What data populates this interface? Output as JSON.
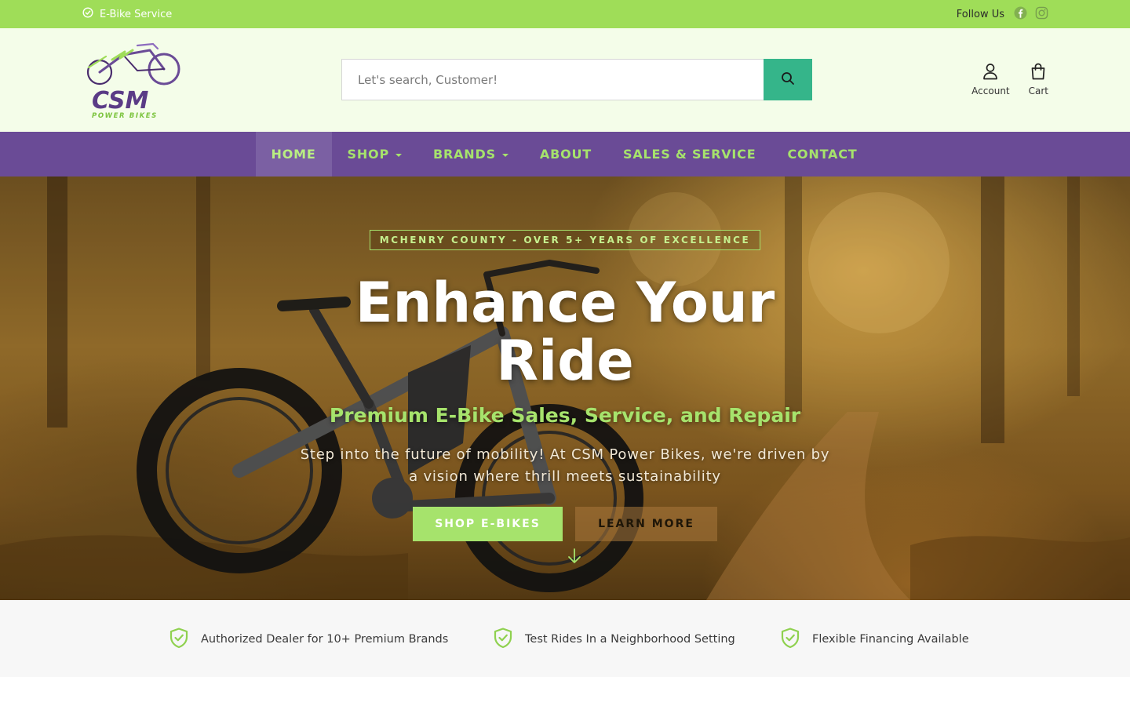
{
  "topbar": {
    "service_label": "E-Bike Service",
    "follow_label": "Follow Us",
    "background": "#9fdd58",
    "icons": [
      "check-circle-icon",
      "facebook-icon",
      "instagram-icon"
    ]
  },
  "header": {
    "logo": {
      "brand": "CSM",
      "tagline": "POWER BIKES"
    },
    "search": {
      "placeholder": "Let's search, Customer!",
      "value": ""
    },
    "account_label": "Account",
    "cart_label": "Cart",
    "background": "#f4fde9",
    "search_button_color": "#35b58a"
  },
  "nav": {
    "background": "#6a4b96",
    "text_color": "#a6e36c",
    "items": [
      {
        "label": "HOME",
        "active": true,
        "dropdown": false
      },
      {
        "label": "SHOP",
        "active": false,
        "dropdown": true
      },
      {
        "label": "BRANDS",
        "active": false,
        "dropdown": true
      },
      {
        "label": "ABOUT",
        "active": false,
        "dropdown": false
      },
      {
        "label": "SALES & SERVICE",
        "active": false,
        "dropdown": false
      },
      {
        "label": "CONTACT",
        "active": false,
        "dropdown": false
      }
    ]
  },
  "hero": {
    "badge": "MCHENRY COUNTY - OVER 5+ YEARS OF EXCELLENCE",
    "title_line1": "Enhance Your",
    "title_line2": "Ride",
    "subtitle": "Premium E-Bike Sales, Service, and Repair",
    "description": "Step into the future of mobility! At CSM Power Bikes, we're driven by a vision where thrill meets sustainability",
    "primary_cta": "SHOP E-BIKES",
    "secondary_cta": "LEARN MORE",
    "accent": "#a6e36c"
  },
  "features": [
    {
      "icon": "shield-check-icon",
      "text": "Authorized Dealer for 10+ Premium Brands"
    },
    {
      "icon": "shield-check-icon",
      "text": "Test Rides In a Neighborhood Setting"
    },
    {
      "icon": "shield-check-icon",
      "text": "Flexible Financing Available"
    }
  ]
}
